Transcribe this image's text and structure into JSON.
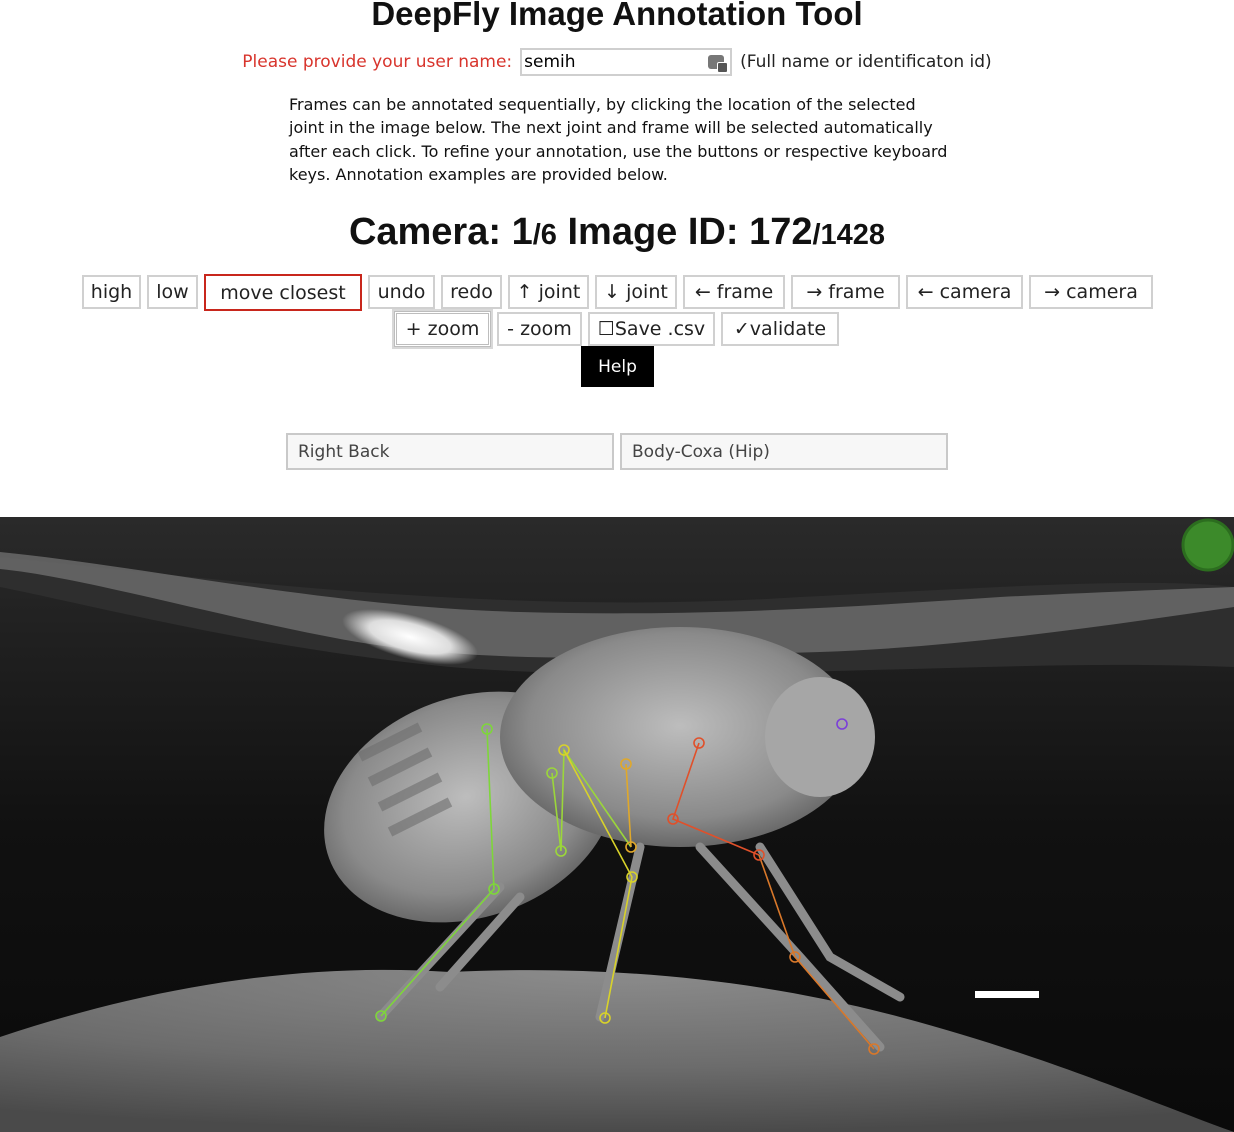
{
  "app": {
    "title": "DeepFly Image Annotation Tool"
  },
  "user": {
    "label": "Please provide your user name:",
    "value": "semih",
    "hint": "(Full name or identificaton id)"
  },
  "instructions": "Frames can be annotated sequentially, by clicking the location of the selected joint in the image below. The next joint and frame will be selected automatically after each click. To refine your annotation, use the buttons or respective keyboard keys. Annotation examples are provided below.",
  "status": {
    "camera_label": "Camera:",
    "camera_current": "1",
    "camera_total": "/6",
    "image_label": "Image ID:",
    "image_current": "172",
    "image_total": "/1428"
  },
  "toolbar": {
    "high": "high",
    "low": "low",
    "move_closest": "move closest",
    "undo": "undo",
    "redo": "redo",
    "joint_up": "↑ joint",
    "joint_down": "↓ joint",
    "frame_prev": "← frame",
    "frame_next": "→ frame",
    "camera_prev": "← camera",
    "camera_next": "→ camera",
    "zoom_in": "+ zoom",
    "zoom_out": "- zoom",
    "save_csv": "☐Save .csv",
    "validate": "✓validate",
    "help": "Help"
  },
  "selection": {
    "leg": "Right Back",
    "joint": "Body-Coxa (Hip)"
  },
  "viewer": {
    "status_indicator_color": "#3c8a2a",
    "skeleton_colors": {
      "back_leg": "#7ed63a",
      "middle_leg_a": "#d8d22a",
      "middle_leg_b": "#e0a82a",
      "front_leg": "#e0502a",
      "front_leg_tip": "#d9782a",
      "head_marker": "#7b3fd8"
    }
  }
}
